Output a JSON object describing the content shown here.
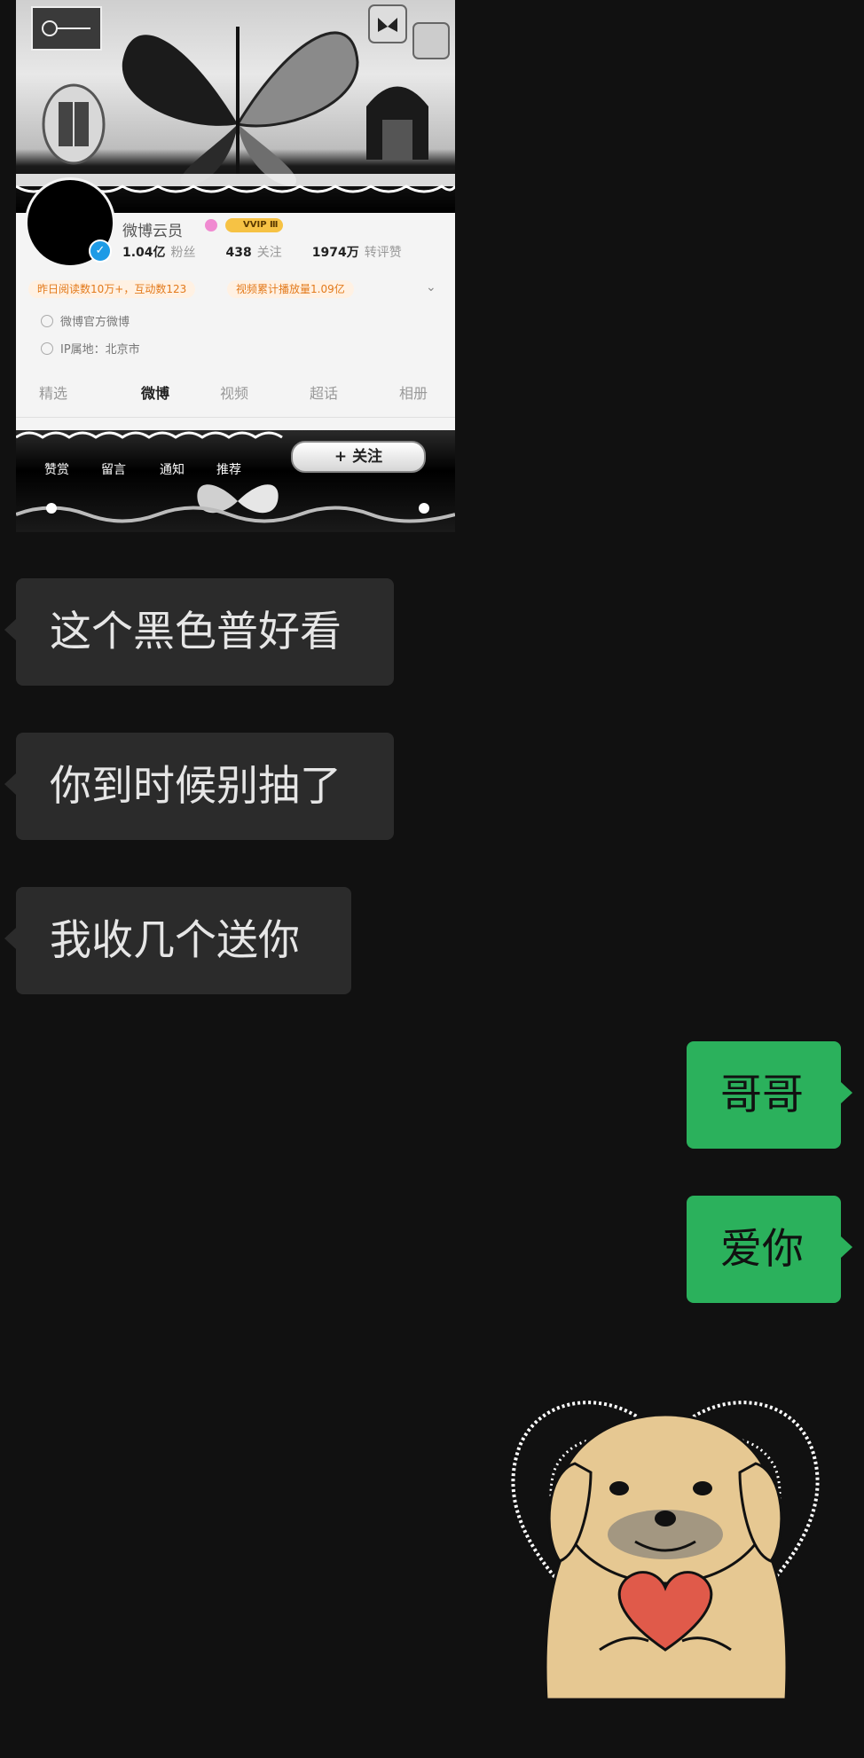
{
  "shared_image": {
    "profile": {
      "name": "微博云员",
      "vip_badge": "VVIP Ⅲ",
      "stats": [
        {
          "value": "1.04亿",
          "label": "粉丝"
        },
        {
          "value": "438",
          "label": "关注"
        },
        {
          "value": "1974万",
          "label": "转评赞"
        }
      ],
      "highlights": [
        "昨日阅读数10万+，互动数123",
        "视频累计播放量1.09亿"
      ],
      "official_label": "微博官方微博",
      "ip_location": "IP属地：北京市"
    },
    "tabs": [
      "精选",
      "微博",
      "视频",
      "超话",
      "相册"
    ],
    "active_tab": "微博",
    "footer_tabs": [
      "赞赏",
      "留言",
      "通知",
      "推荐"
    ],
    "follow_button": "+ 关注",
    "colors": {
      "verify": "#1e9be6",
      "vip": "#f6c244",
      "highlight_text": "#e37a1b"
    }
  },
  "messages": [
    {
      "side": "left",
      "text": "这个黑色普好看"
    },
    {
      "side": "left",
      "text": "你到时候别抽了"
    },
    {
      "side": "left",
      "text": "我收几个送你"
    },
    {
      "side": "right",
      "text": "哥哥"
    },
    {
      "side": "right",
      "text": "爱你"
    }
  ],
  "sticker": {
    "icon": "dog-holding-heart-icon"
  },
  "colors": {
    "background": "#111111",
    "incoming_bubble": "#2b2b2b",
    "outgoing_bubble": "#2bb15c"
  }
}
